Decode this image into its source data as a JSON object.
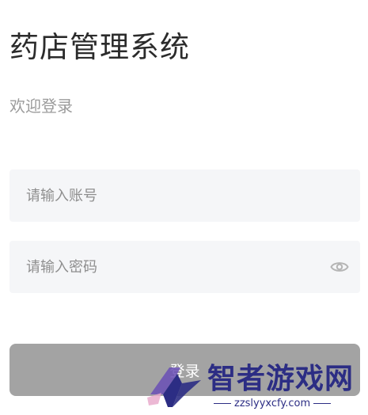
{
  "header": {
    "title": "药店管理系统",
    "subtitle": "欢迎登录"
  },
  "form": {
    "account": {
      "placeholder": "请输入账号",
      "value": ""
    },
    "password": {
      "placeholder": "请输入密码",
      "value": "",
      "toggle_icon": "eye-icon"
    },
    "login_label": "登录"
  },
  "watermark": {
    "brand": "智者游戏网",
    "url": "zzslyyxcfy.com"
  },
  "colors": {
    "title": "#2b2b2b",
    "subtitle": "#9b9b9b",
    "field_bg": "#f5f6f8",
    "placeholder": "#8e8e8e",
    "button_bg": "#a3a3a3",
    "button_text": "#ffffff",
    "watermark": "#2c2d84"
  }
}
